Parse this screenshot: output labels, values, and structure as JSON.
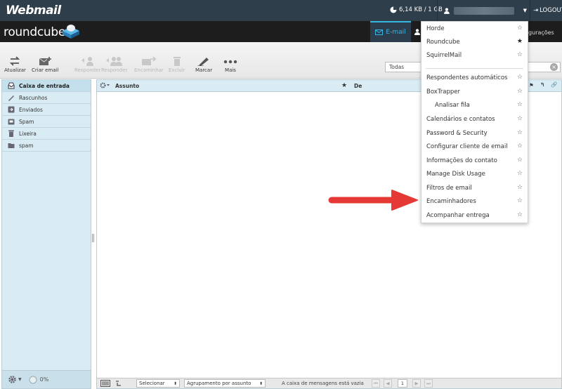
{
  "header": {
    "logo": "Webmail",
    "quota": "6,14 KB / 1 GB",
    "logout": "LOGOUT"
  },
  "appbar": {
    "logo": "roundcube",
    "email_tab": "E-mail",
    "settings_tab": "gurações"
  },
  "toolbar": {
    "buttons": [
      {
        "label": "Atualizar",
        "icon": "refresh-icon",
        "enabled": true
      },
      {
        "label": "Criar email",
        "icon": "compose-icon",
        "enabled": true
      },
      {
        "label": "Responder",
        "icon": "reply-icon",
        "enabled": false
      },
      {
        "label": "Responder",
        "icon": "reply-all-icon",
        "enabled": false
      },
      {
        "label": "Encaminhar",
        "icon": "forward-icon",
        "enabled": false
      },
      {
        "label": "Excluir",
        "icon": "trash-icon",
        "enabled": false
      },
      {
        "label": "Marcar",
        "icon": "mark-icon",
        "enabled": true
      },
      {
        "label": "Mais",
        "icon": "more-icon",
        "enabled": true
      }
    ],
    "search_scope": "Todas"
  },
  "folders": [
    {
      "label": "Caixa de entrada",
      "icon": "inbox-icon",
      "selected": true
    },
    {
      "label": "Rascunhos",
      "icon": "drafts-icon",
      "selected": false
    },
    {
      "label": "Enviados",
      "icon": "sent-icon",
      "selected": false
    },
    {
      "label": "Spam",
      "icon": "spam-icon",
      "selected": false
    },
    {
      "label": "Lixeira",
      "icon": "trash-icon",
      "selected": false
    },
    {
      "label": "spam",
      "icon": "folder-icon",
      "selected": false
    }
  ],
  "folders_footer": {
    "quota_percent": "0%"
  },
  "message_list": {
    "col_subject": "Assunto",
    "col_from": "De",
    "select_label": "Selecionar",
    "threading_label": "Agrupamento por assunto",
    "empty_status": "A caixa de mensagens está vazia",
    "page_number": "1"
  },
  "menu": {
    "items": [
      {
        "label": "Horde",
        "starred": false,
        "indent": false
      },
      {
        "label": "Roundcube",
        "starred": true,
        "indent": false
      },
      {
        "label": "SquirrelMail",
        "starred": false,
        "indent": false
      },
      {
        "label": "Respondentes automáticos",
        "starred": false,
        "indent": false
      },
      {
        "label": "BoxTrapper",
        "starred": false,
        "indent": false
      },
      {
        "label": "Analisar fila",
        "starred": false,
        "indent": true
      },
      {
        "label": "Calendários e contatos",
        "starred": false,
        "indent": false
      },
      {
        "label": "Password & Security",
        "starred": false,
        "indent": false
      },
      {
        "label": "Configurar cliente de email",
        "starred": false,
        "indent": false
      },
      {
        "label": "Informações do contato",
        "starred": false,
        "indent": false
      },
      {
        "label": "Manage Disk Usage",
        "starred": false,
        "indent": false
      },
      {
        "label": "Filtros de email",
        "starred": false,
        "indent": false
      },
      {
        "label": "Encaminhadores",
        "starred": false,
        "indent": false
      },
      {
        "label": "Acompanhar entrega",
        "starred": false,
        "indent": false
      }
    ]
  },
  "colors": {
    "header_bg": "#2f3e4b",
    "appbar_bg": "#1d1d1d",
    "accent": "#37b6e6",
    "folder_bg": "#d9ecf4",
    "arrow": "#e53935"
  }
}
